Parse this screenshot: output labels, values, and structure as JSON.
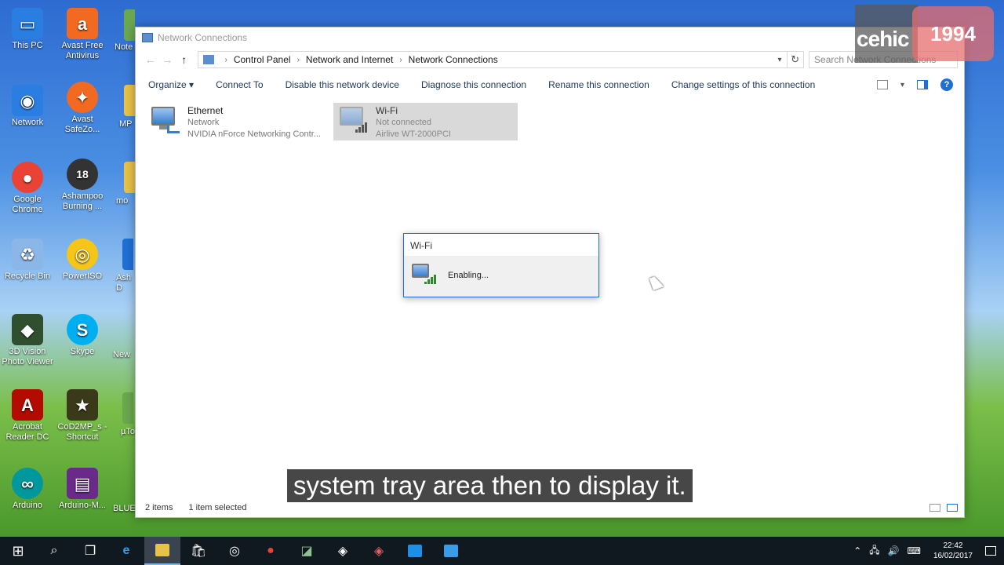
{
  "desktop": {
    "icons": [
      {
        "label": "This PC",
        "color": "#2a7de1",
        "glyph": "▭"
      },
      {
        "label": "Avast Free Antivirus",
        "color": "#f26a21",
        "glyph": "a"
      },
      {
        "label": "Network",
        "color": "#2a7de1",
        "glyph": "◉"
      },
      {
        "label": "Avast SafeZo...",
        "color": "#f26a21",
        "glyph": "✦"
      },
      {
        "label": "Google Chrome",
        "color": "#ea4335",
        "glyph": "●"
      },
      {
        "label": "Ashampoo Burning ...",
        "color": "#333333",
        "glyph": "18"
      },
      {
        "label": "Recycle Bin",
        "color": "#8bb6e8",
        "glyph": "♻"
      },
      {
        "label": "PowerISO",
        "color": "#f5c518",
        "glyph": "◎"
      },
      {
        "label": "3D Vision Photo Viewer",
        "color": "#2f4f2f",
        "glyph": "◆"
      },
      {
        "label": "Skype",
        "color": "#00aff0",
        "glyph": "S"
      },
      {
        "label": "Acrobat Reader DC",
        "color": "#b30b00",
        "glyph": "A"
      },
      {
        "label": "CoD2MP_s - Shortcut",
        "color": "#3a3a1a",
        "glyph": "★"
      },
      {
        "label": "Arduino",
        "color": "#00979d",
        "glyph": "∞"
      },
      {
        "label": "Arduino-M...",
        "color": "#6a2a8a",
        "glyph": "▤"
      }
    ],
    "partial_labels": [
      "Note",
      "MP",
      "mo",
      "Ash D",
      "New",
      "µTo",
      "BLUE"
    ]
  },
  "window": {
    "title": "Network Connections",
    "breadcrumbs": [
      "Control Panel",
      "Network and Internet",
      "Network Connections"
    ],
    "search_placeholder": "Search Network Connections",
    "toolbar": {
      "organize": "Organize ▾",
      "connect_to": "Connect To",
      "disable": "Disable this network device",
      "diagnose": "Diagnose this connection",
      "rename": "Rename this connection",
      "change_settings": "Change settings of this connection",
      "help": "?"
    },
    "connections": [
      {
        "name": "Ethernet",
        "status": "Network",
        "device": "NVIDIA nForce Networking Contr..."
      },
      {
        "name": "Wi-Fi",
        "status": "Not connected",
        "device": "Airlive WT-2000PCI"
      }
    ],
    "status_bar": {
      "items": "2 items",
      "selected": "1 item selected"
    }
  },
  "dialog": {
    "title": "Wi-Fi",
    "message": "Enabling..."
  },
  "caption": "system tray area then to display it.",
  "watermark": {
    "left": "cehic",
    "right": "1994"
  },
  "taskbar": {
    "clock_time": "22:42",
    "clock_date": "16/02/2017"
  },
  "colors": {
    "accent": "#1f6fd6",
    "selection": "#d9d9d9",
    "taskbar": "#101820"
  }
}
